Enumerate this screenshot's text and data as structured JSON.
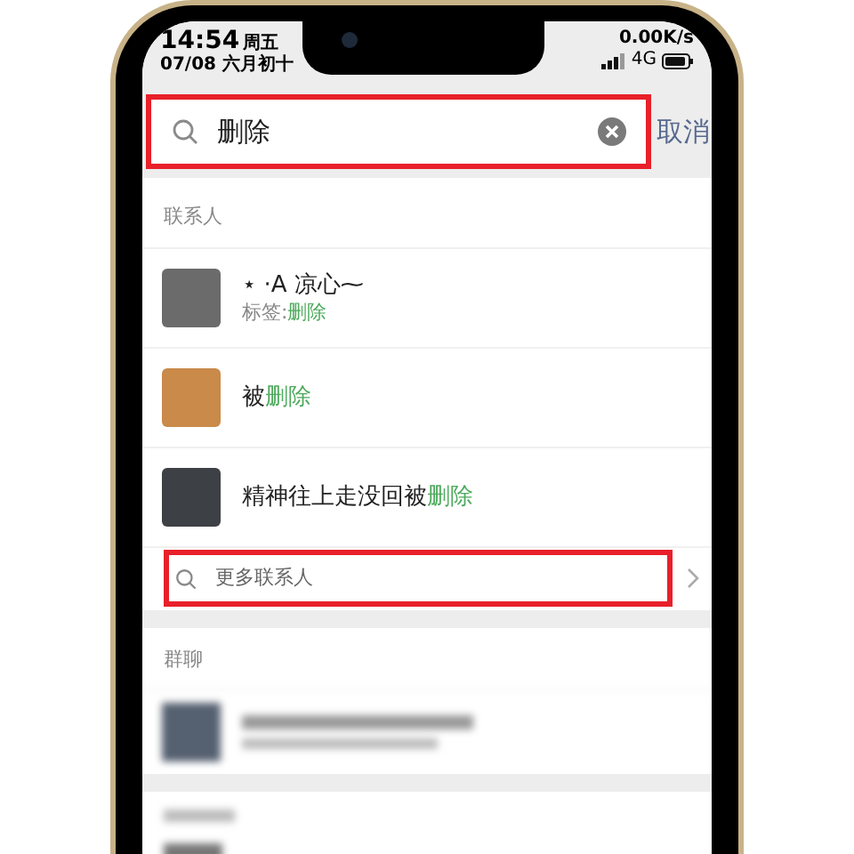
{
  "status_bar": {
    "time": "14:54",
    "weekday": "周五",
    "date": "07/08 六月初十",
    "network_speed": "0.00K/s",
    "network": "4G"
  },
  "search": {
    "value": "删除",
    "cancel": "取消"
  },
  "contacts": {
    "title": "联系人",
    "items": [
      {
        "name": [
          {
            "text": "⋆ ·A 凉心⁓",
            "match": false
          }
        ],
        "tag": [
          {
            "text": "标签:",
            "match": false
          },
          {
            "text": "删除",
            "match": true
          }
        ]
      },
      {
        "name": [
          {
            "text": "被",
            "match": false
          },
          {
            "text": "删除",
            "match": true
          }
        ]
      },
      {
        "name": [
          {
            "text": "精神往上走没回被",
            "match": false
          },
          {
            "text": "删除",
            "match": true
          }
        ]
      }
    ],
    "more": "更多联系人"
  },
  "group_chats": {
    "title": "群聊"
  }
}
